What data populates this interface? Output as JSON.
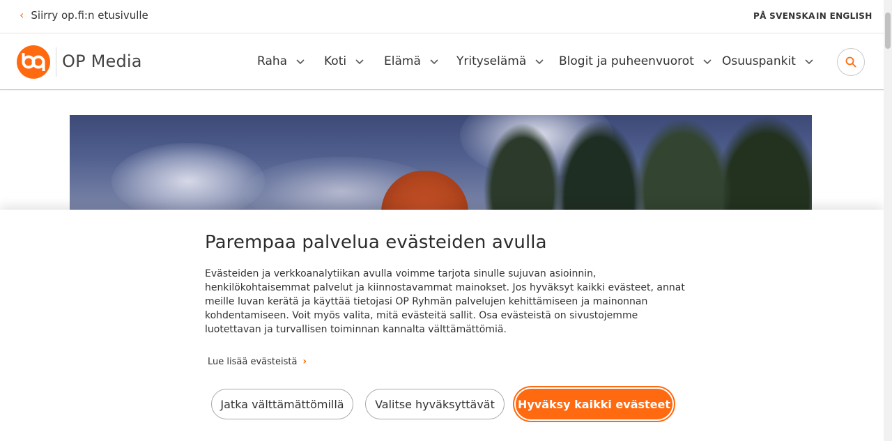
{
  "topbar": {
    "back_link": "Siirry op.fi:n etusivulle",
    "lang_sv": "PÅ SVENSKA",
    "lang_en": "IN ENGLISH"
  },
  "header": {
    "brand": "OP Media",
    "nav": [
      {
        "label": "Raha"
      },
      {
        "label": "Koti"
      },
      {
        "label": "Elämä"
      },
      {
        "label": "Yrityselämä"
      },
      {
        "label": "Blogit ja puheenvuorot"
      },
      {
        "label": "Osuuspankit"
      }
    ]
  },
  "consent": {
    "title": "Parempaa palvelua evästeiden avulla",
    "text": "Evästeiden ja verkkoanalytiikan avulla voimme tarjota sinulle sujuvan asioinnin, henkilökohtaisemmat palvelut ja kiinnostavammat mainokset. Jos hyväksyt kaikki evästeet, annat meille luvan kerätä ja käyttää tietojasi OP Ryhmän palvelujen kehittämiseen ja mainonnan kohdentamiseen. Voit myös valita, mitä evästeitä sallit. Osa evästeistä on sivustojemme luotettavan ja turvallisen toiminnan kannalta välttämättömiä.",
    "read_more": "Lue lisää evästeistä",
    "btn_essential": "Jatka välttämättömillä",
    "btn_choose": "Valitse hyväksyttävät",
    "btn_accept": "Hyväksy kaikki evästeet"
  },
  "colors": {
    "accent": "#ff6a10"
  },
  "icons": {
    "back": "chevron-left-icon",
    "nav": "chevron-down-icon",
    "search": "search-icon",
    "read_more": "chevron-right-icon"
  }
}
